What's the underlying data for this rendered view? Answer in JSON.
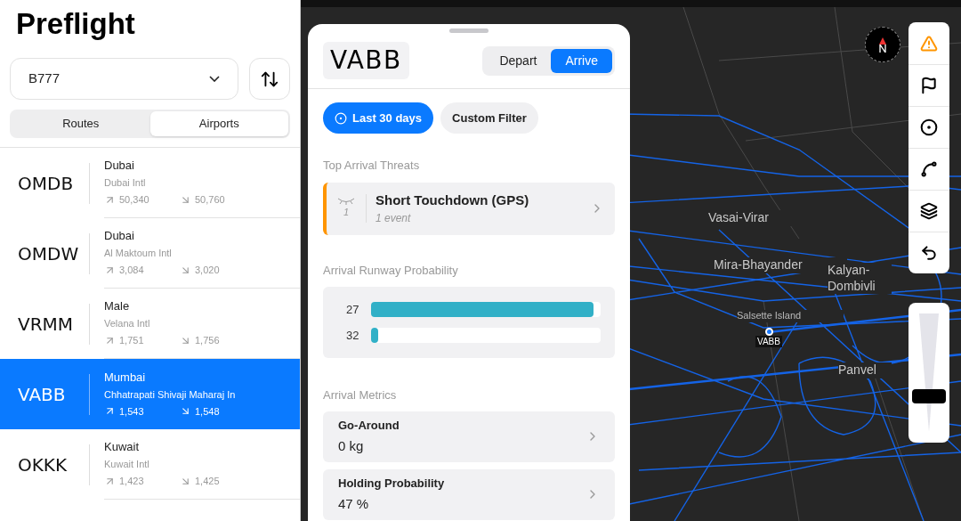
{
  "sidebar": {
    "title": "Preflight",
    "aircraft_select": {
      "value": "B777"
    },
    "tabs": [
      {
        "label": "Routes",
        "selected": false
      },
      {
        "label": "Airports",
        "selected": true
      }
    ],
    "airports": [
      {
        "code": "OMDB",
        "city": "Dubai",
        "name": "Dubai Intl",
        "departures": "50,340",
        "arrivals": "50,760",
        "selected": false
      },
      {
        "code": "OMDW",
        "city": "Dubai",
        "name": "Al Maktoum Intl",
        "departures": "3,084",
        "arrivals": "3,020",
        "selected": false
      },
      {
        "code": "VRMM",
        "city": "Male",
        "name": "Velana Intl",
        "departures": "1,751",
        "arrivals": "1,756",
        "selected": false
      },
      {
        "code": "VABB",
        "city": "Mumbai",
        "name": "Chhatrapati Shivaji Maharaj In",
        "departures": "1,543",
        "arrivals": "1,548",
        "selected": true
      },
      {
        "code": "OKKK",
        "city": "Kuwait",
        "name": "Kuwait Intl",
        "departures": "1,423",
        "arrivals": "1,425",
        "selected": false
      }
    ]
  },
  "detail_panel": {
    "airport_code": "VABB",
    "direction_tabs": [
      {
        "label": "Depart",
        "selected": false
      },
      {
        "label": "Arrive",
        "selected": true
      }
    ],
    "filters": [
      {
        "label": "Last 30 days",
        "selected": true
      },
      {
        "label": "Custom Filter",
        "selected": false
      }
    ],
    "threats": {
      "heading": "Top Arrival Threats",
      "items": [
        {
          "count": "1",
          "title": "Short Touchdown (GPS)",
          "subtitle": "1 event"
        }
      ]
    },
    "runway_probability": {
      "heading": "Arrival Runway Probability",
      "runways": [
        {
          "runway": "27",
          "level": 0.97
        },
        {
          "runway": "32",
          "level": 0.03
        }
      ]
    },
    "metrics": {
      "heading": "Arrival Metrics",
      "items": [
        {
          "label": "Go-Around",
          "value": "0 kg"
        },
        {
          "label": "Holding Probability",
          "value": "47 %"
        }
      ]
    }
  },
  "map": {
    "labels": [
      {
        "text": "Vasai-Virar",
        "kind": "city"
      },
      {
        "text": "Mira-Bhayander",
        "kind": "city"
      },
      {
        "text": "Kalyan-Dombivli",
        "kind": "city"
      },
      {
        "text": "Salsette Island",
        "kind": "area"
      },
      {
        "text": "Panvel",
        "kind": "city"
      }
    ],
    "airport_marker": {
      "label": "VABB"
    },
    "zoom_slider": {
      "level": 0.3
    }
  }
}
